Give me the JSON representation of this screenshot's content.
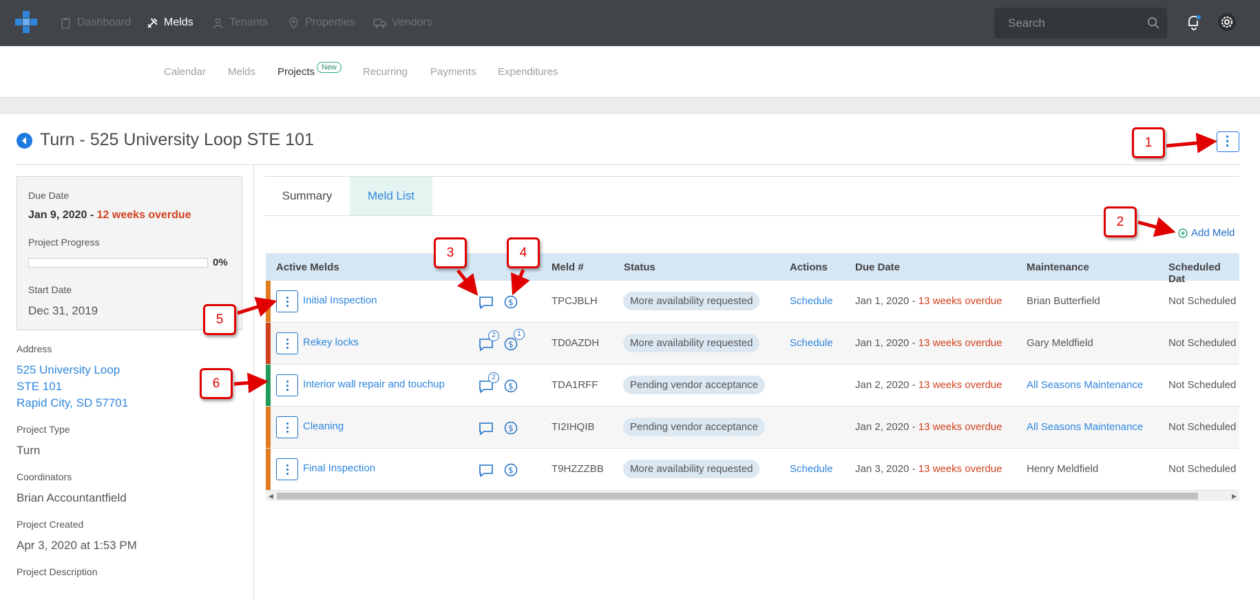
{
  "topnav": {
    "items": [
      {
        "label": "Dashboard",
        "icon": "clipboard-icon"
      },
      {
        "label": "Melds",
        "icon": "tools-icon"
      },
      {
        "label": "Tenants",
        "icon": "person-icon"
      },
      {
        "label": "Properties",
        "icon": "location-pin-icon"
      },
      {
        "label": "Vendors",
        "icon": "truck-icon"
      }
    ],
    "search_placeholder": "Search"
  },
  "subnav": {
    "items": [
      "Calendar",
      "Melds",
      "Projects",
      "Recurring",
      "Payments",
      "Expenditures"
    ],
    "new_badge": "New"
  },
  "page": {
    "title": "Turn - 525 University Loop STE 101"
  },
  "project": {
    "due_date_label": "Due Date",
    "due_date": "Jan 9, 2020 -",
    "due_overdue": "12 weeks overdue",
    "progress_label": "Project Progress",
    "progress_value": 0,
    "progress_text": "0%",
    "start_date_label": "Start Date",
    "start_date": "Dec 31, 2019",
    "address_label": "Address",
    "address_lines": [
      "525 University Loop",
      "STE 101",
      "Rapid City, SD 57701"
    ],
    "type_label": "Project Type",
    "type": "Turn",
    "coordinators_label": "Coordinators",
    "coordinators": "Brian Accountantfield",
    "created_label": "Project Created",
    "created": "Apr 3, 2020 at 1:53 PM",
    "description_label": "Project Description"
  },
  "tabs": {
    "summary": "Summary",
    "meld_list": "Meld List"
  },
  "add_meld": "Add Meld",
  "table": {
    "headers": {
      "active": "Active Melds",
      "meld_no": "Meld #",
      "status": "Status",
      "actions": "Actions",
      "due": "Due Date",
      "maintenance": "Maintenance",
      "scheduled": "Scheduled Dat"
    },
    "rows": [
      {
        "name": "Initial Inspection",
        "chat_count": "",
        "money_count": "",
        "meld_no": "TPCJBLH",
        "status": "More availability requested",
        "action": "Schedule",
        "due": "Jan 1, 2020 -",
        "overdue": "13 weeks overdue",
        "maintenance": "Brian Butterfield",
        "scheduled": "Not Scheduled",
        "strip": "#e07b1f"
      },
      {
        "name": "Rekey locks",
        "chat_count": "2",
        "money_count": "1",
        "meld_no": "TD0AZDH",
        "status": "More availability requested",
        "action": "Schedule",
        "due": "Jan 1, 2020 -",
        "overdue": "13 weeks overdue",
        "maintenance": "Gary Meldfield",
        "scheduled": "Not Scheduled",
        "strip": "#d0411e"
      },
      {
        "name": "Interior wall repair and touchup",
        "chat_count": "2",
        "money_count": "",
        "meld_no": "TDA1RFF",
        "status": "Pending vendor acceptance",
        "action": "",
        "due": "Jan 2, 2020 -",
        "overdue": "13 weeks overdue",
        "maintenance": "All Seasons Maintenance",
        "scheduled": "Not Scheduled",
        "strip": "#1f9a5a"
      },
      {
        "name": "Cleaning",
        "chat_count": "",
        "money_count": "",
        "meld_no": "TI2IHQIB",
        "status": "Pending vendor acceptance",
        "action": "",
        "due": "Jan 2, 2020 -",
        "overdue": "13 weeks overdue",
        "maintenance": "All Seasons Maintenance",
        "scheduled": "Not Scheduled",
        "strip": "#e07b1f"
      },
      {
        "name": "Final Inspection",
        "chat_count": "",
        "money_count": "",
        "meld_no": "T9HZZZBB",
        "status": "More availability requested",
        "action": "Schedule",
        "due": "Jan 3, 2020 -",
        "overdue": "13 weeks overdue",
        "maintenance": "Henry Meldfield",
        "scheduled": "Not Scheduled",
        "strip": "#e07b1f"
      }
    ]
  },
  "callouts": [
    "1",
    "2",
    "3",
    "4",
    "5",
    "6"
  ],
  "colors": {
    "accent": "#1f7ae0",
    "overdue": "#d0411e",
    "topbar": "#414549",
    "annotation": "#e00000"
  }
}
